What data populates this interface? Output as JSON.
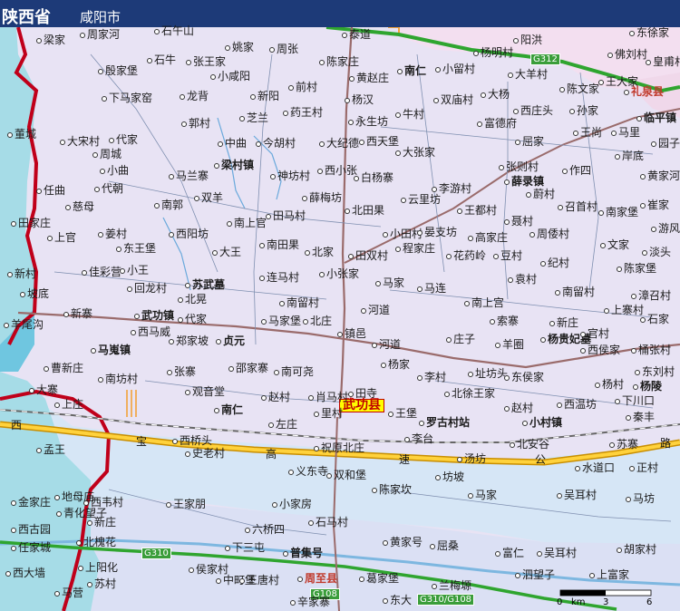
{
  "header": {
    "province": "陕西省",
    "city": "咸阳市"
  },
  "county_seat": "武功县",
  "road_labels": {
    "g312": "G312",
    "g310": "G310",
    "g108": "G108",
    "g310_g108": "G310/G108"
  },
  "expressway_chars": [
    "西",
    "宝",
    "高",
    "速",
    "公",
    "路"
  ],
  "scale": {
    "zero": "0",
    "unit": "km",
    "three": "3",
    "six": "6"
  },
  "places": [
    "梁家",
    "周家河",
    "石午山",
    "姚家",
    "周张",
    "泰道",
    "阳洪",
    "东徐家",
    "佛刘村",
    "皇甫村",
    "王大家",
    "礼泉县",
    "殷家堡",
    "石牛",
    "张王家",
    "小咸阳",
    "陈家庄",
    "黄赵庄",
    "南仁",
    "小留村",
    "杨明村",
    "大羊村",
    "下马家窑",
    "龙背",
    "新阳",
    "前村",
    "杨汉",
    "双庙村",
    "大杨",
    "陈文家",
    "西庄头",
    "孙家",
    "临平镇",
    "董城",
    "郭村",
    "芝兰",
    "药王村",
    "永生坊",
    "牛村",
    "富德府",
    "王尚",
    "马里",
    "园子村",
    "大宋村",
    "代家",
    "中曲",
    "今胡村",
    "大纪德",
    "西天堡",
    "大张家",
    "屈家",
    "岸底",
    "周城",
    "小曲",
    "梁村镇",
    "西小张",
    "白杨寨",
    "张则村",
    "作四",
    "黄家河",
    "任曲",
    "代朝",
    "马兰寨",
    "神坊村",
    "薛录镇",
    "李游村",
    "蔚村",
    "崔家",
    "南郭",
    "双羊",
    "薛梅坊",
    "云里坊",
    "召首村",
    "南家堡",
    "田家庄",
    "慈母",
    "西阳坊",
    "南上官",
    "田马村",
    "北田果",
    "王都村",
    "聂村",
    "游风",
    "上官",
    "姜村",
    "小田村",
    "晏支坊",
    "高家庄",
    "周倭村",
    "文家",
    "淡头",
    "东王堡",
    "南田果",
    "程家庄",
    "豆村",
    "大王",
    "北家",
    "田双村",
    "花药岭",
    "新村",
    "佳彩营",
    "小王",
    "小张家",
    "马家",
    "马连",
    "纪村",
    "陈家堡",
    "坡底",
    "回龙村",
    "苏武墓",
    "北晃",
    "连马村",
    "袁村",
    "南留村",
    "南留村",
    "漳召村",
    "新寨",
    "武功镇",
    "代家",
    "马家堡",
    "北庄",
    "河道",
    "南上宫",
    "上寨村",
    "西马威",
    "索寨",
    "新庄",
    "石家",
    "羊尾沟",
    "郑家坡",
    "贞元",
    "镇邑",
    "河道",
    "庄子",
    "羊圈",
    "杨贵妃墓",
    "官村",
    "马嵬镇",
    "西侯家",
    "桶张村",
    "曹新庄",
    "张寨",
    "邵家寨",
    "南可尧",
    "杨家",
    "址坊头",
    "东侯家",
    "东刘村",
    "杨陵",
    "大寨",
    "南坊村",
    "上庄",
    "李村",
    "杨村",
    "观音堂",
    "赵村",
    "肖马村",
    "田寺",
    "北徐王家",
    "赵村",
    "西温坊",
    "下川口",
    "南仁",
    "里村",
    "王堡",
    "秦丰",
    "孟王",
    "左庄",
    "小村镇",
    "罗古村站",
    "李台",
    "西桥头",
    "史老村",
    "祝原北庄",
    "北安谷",
    "苏寨",
    "义东寺",
    "双和堡",
    "坊坡",
    "汤坊",
    "水道口",
    "正村",
    "陈家坎",
    "马家",
    "吴耳村",
    "马坊",
    "地母庙",
    "王家朋",
    "小家房",
    "青化望子",
    "西韦村",
    "新庄",
    "六桥四",
    "石马村",
    "金家庄",
    "西古园",
    "北槐花",
    "下三屯",
    "普集号",
    "黄家号",
    "屈桑",
    "富仁",
    "吴耳村",
    "胡家村",
    "任家城",
    "上阳化",
    "侯家村",
    "周至县",
    "葛家堡",
    "泗望子",
    "上富家",
    "西大墙",
    "苏村",
    "中町堡",
    "王唐村",
    "兰梅塬",
    "马营",
    "辛家寨",
    "东大"
  ]
}
